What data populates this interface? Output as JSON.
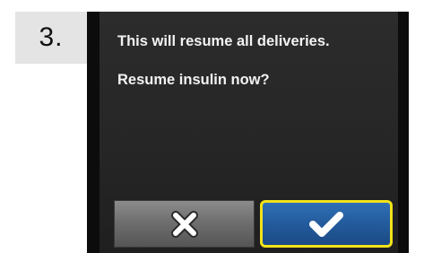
{
  "step": {
    "number": "3."
  },
  "dialog": {
    "message_line_1": "This will resume all deliveries.",
    "message_line_2": "Resume insulin now?"
  },
  "buttons": {
    "cancel": {
      "icon": "close-icon",
      "color": "#6f6f6f"
    },
    "confirm": {
      "icon": "checkmark-icon",
      "color": "#235b9c",
      "highlight_color": "#f2e21a",
      "selected": true
    }
  }
}
